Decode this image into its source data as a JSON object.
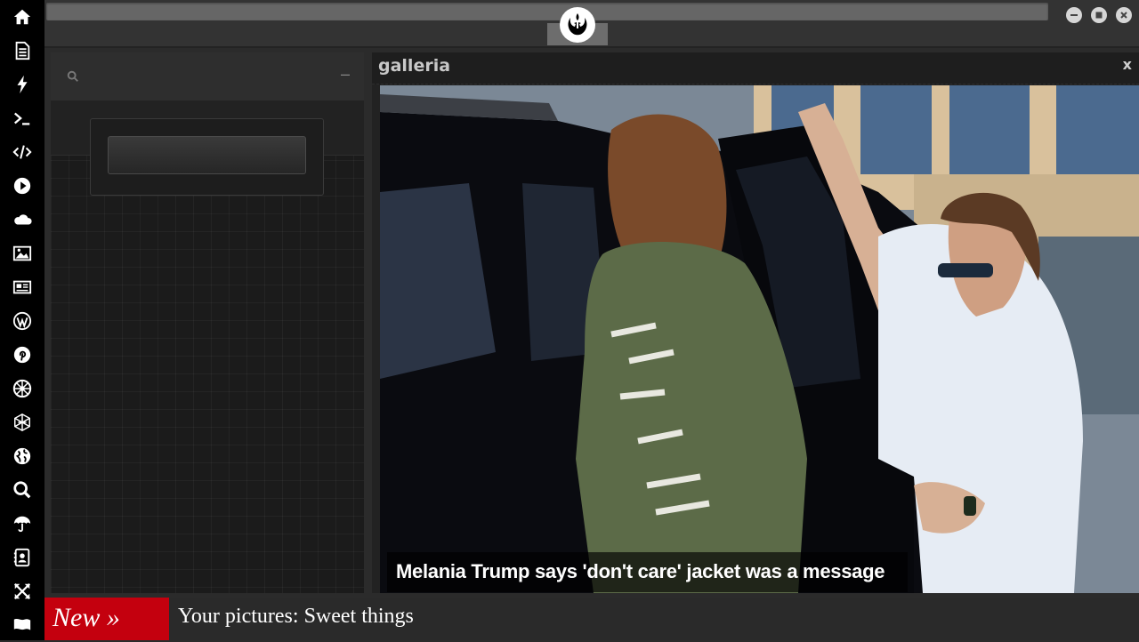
{
  "rail": {
    "items": [
      {
        "name": "home-icon"
      },
      {
        "name": "document-icon"
      },
      {
        "name": "lightning-icon"
      },
      {
        "name": "terminal-icon"
      },
      {
        "name": "code-icon"
      },
      {
        "name": "play-icon"
      },
      {
        "name": "cloud-icon"
      },
      {
        "name": "image-icon"
      },
      {
        "name": "newspaper-icon"
      },
      {
        "name": "wordpress-icon"
      },
      {
        "name": "pinterest-icon"
      },
      {
        "name": "galactic-empire-icon"
      },
      {
        "name": "geodesic-icon"
      },
      {
        "name": "globe-icon"
      },
      {
        "name": "search-icon"
      },
      {
        "name": "umbrella-icon"
      },
      {
        "name": "contacts-icon"
      },
      {
        "name": "expand-icon"
      },
      {
        "name": "flag-icon"
      }
    ]
  },
  "topbar": {
    "logo": "rebel-alliance-icon",
    "controls": [
      "minimize-icon",
      "maximize-icon",
      "close-icon"
    ]
  },
  "left_panel": {
    "search_icon": "search-icon",
    "minimize_label": "–"
  },
  "gallery": {
    "title": "galleria",
    "close_label": "x",
    "caption": "Melania Trump says 'don't care' jacket was a message"
  },
  "ticker": {
    "badge": "New »",
    "text": "Your pictures: Sweet things"
  }
}
